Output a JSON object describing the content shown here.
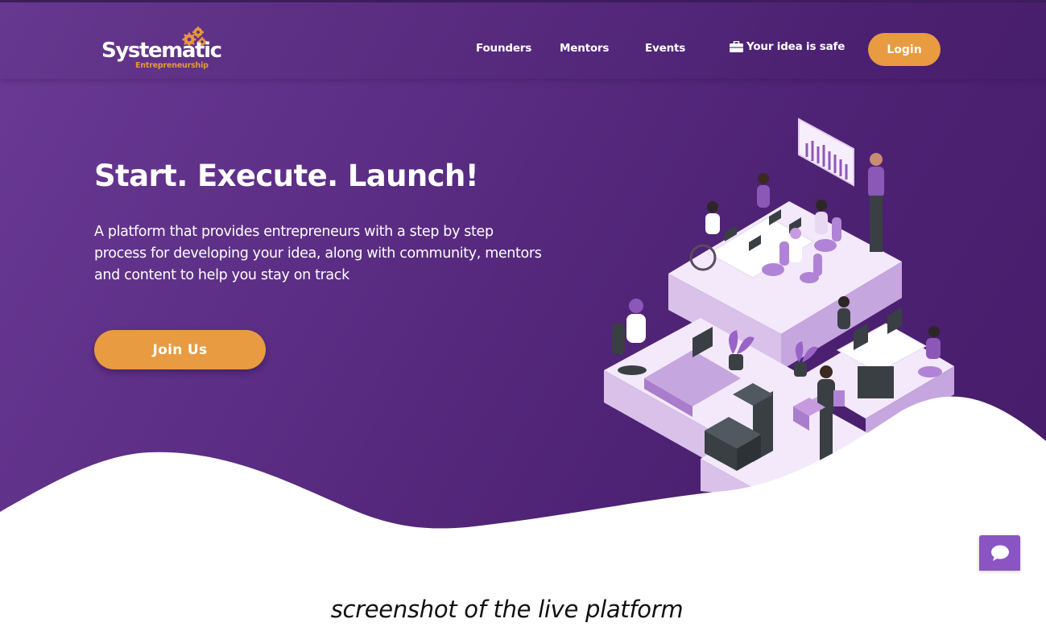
{
  "brand": {
    "name": "Systematic",
    "tagline": "Entrepreneurship",
    "accent_color": "#e89b40",
    "primary_color": "#5b2d84"
  },
  "nav": {
    "items": [
      {
        "label": "Founders"
      },
      {
        "label": "Mentors"
      },
      {
        "label": "Events"
      },
      {
        "label": "Your idea is safe",
        "icon": "briefcase-icon"
      }
    ],
    "login_label": "Login"
  },
  "hero": {
    "title": "Start. Execute. Launch!",
    "description": "A platform that provides entrepreneurs with a step by step process for developing your idea, along with community, mentors and content to help you stay on track",
    "cta_label": "Join Us",
    "illustration": "office-team-illustration"
  },
  "chat": {
    "icon": "chat-bubble-icon"
  },
  "caption": "screenshot of the live platform"
}
